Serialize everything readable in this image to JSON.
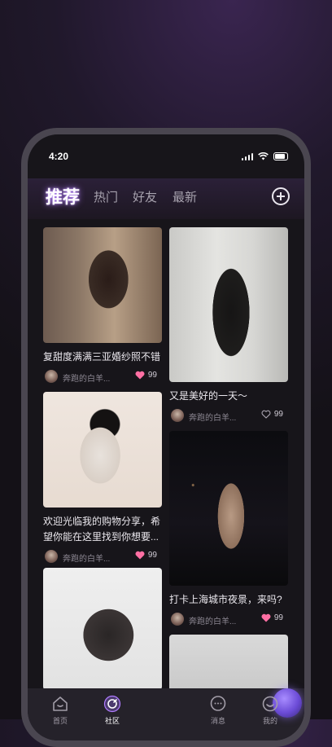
{
  "status": {
    "time": "4:20"
  },
  "tabs": [
    {
      "label": "推荐",
      "active": true
    },
    {
      "label": "热门",
      "active": false
    },
    {
      "label": "好友",
      "active": false
    },
    {
      "label": "最新",
      "active": false
    }
  ],
  "feed": [
    {
      "caption": "复甜度满满三亚婚纱照不错",
      "author": "奔跑的白羊...",
      "likes": "99",
      "liked": true
    },
    {
      "caption": "又是美好的一天～",
      "author": "奔跑的白羊...",
      "likes": "99",
      "liked": false
    },
    {
      "caption": "欢迎光临我的购物分享，希望你能在这里找到你想要...",
      "author": "奔跑的白羊...",
      "likes": "99",
      "liked": true
    },
    {
      "caption": "打卡上海城市夜景，来吗?",
      "author": "奔跑的白羊...",
      "likes": "99",
      "liked": true
    },
    {
      "caption": "",
      "author": "",
      "likes": ""
    },
    {
      "caption": "",
      "author": "",
      "likes": ""
    }
  ],
  "nav": [
    {
      "label": "首页",
      "icon": "home-icon",
      "active": false
    },
    {
      "label": "社区",
      "icon": "compass-icon",
      "active": true
    },
    {
      "label": "",
      "icon": "mascot-icon",
      "active": false
    },
    {
      "label": "消息",
      "icon": "message-icon",
      "active": false
    },
    {
      "label": "我的",
      "icon": "profile-icon",
      "active": false
    }
  ],
  "colors": {
    "accent": "#b07cff",
    "like": "#ff6fa3",
    "background": "#17151a"
  }
}
